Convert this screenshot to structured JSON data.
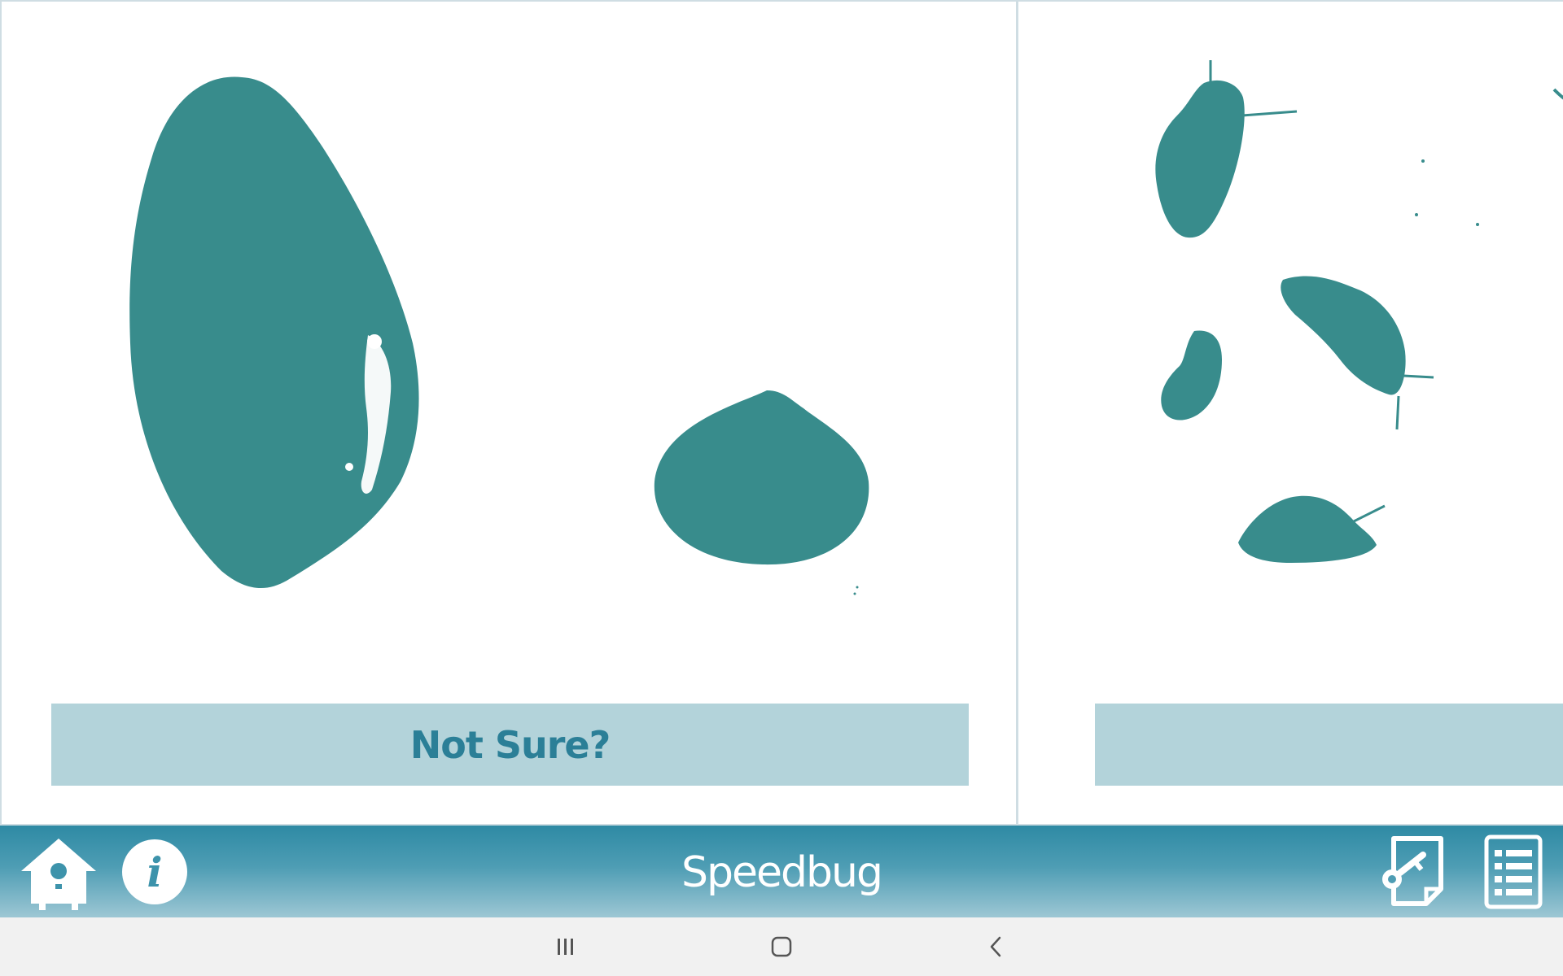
{
  "choices": {
    "left": {
      "label": "Not Sure?"
    },
    "right": {
      "label": ""
    }
  },
  "toolbar": {
    "title": "Speedbug",
    "buttons": [
      "home-icon",
      "info-icon",
      "key-icon",
      "list-icon"
    ]
  },
  "system_nav": {
    "buttons": [
      "recents-icon",
      "home-icon",
      "back-icon"
    ]
  },
  "colors": {
    "shape_teal": "#388c8c",
    "button_bg": "#b3d3da",
    "button_text": "#2b7f97",
    "toolbar_top": "#2e8aa4",
    "toolbar_bottom": "#9dc7d4",
    "nav_bg": "#f1f1f1"
  }
}
